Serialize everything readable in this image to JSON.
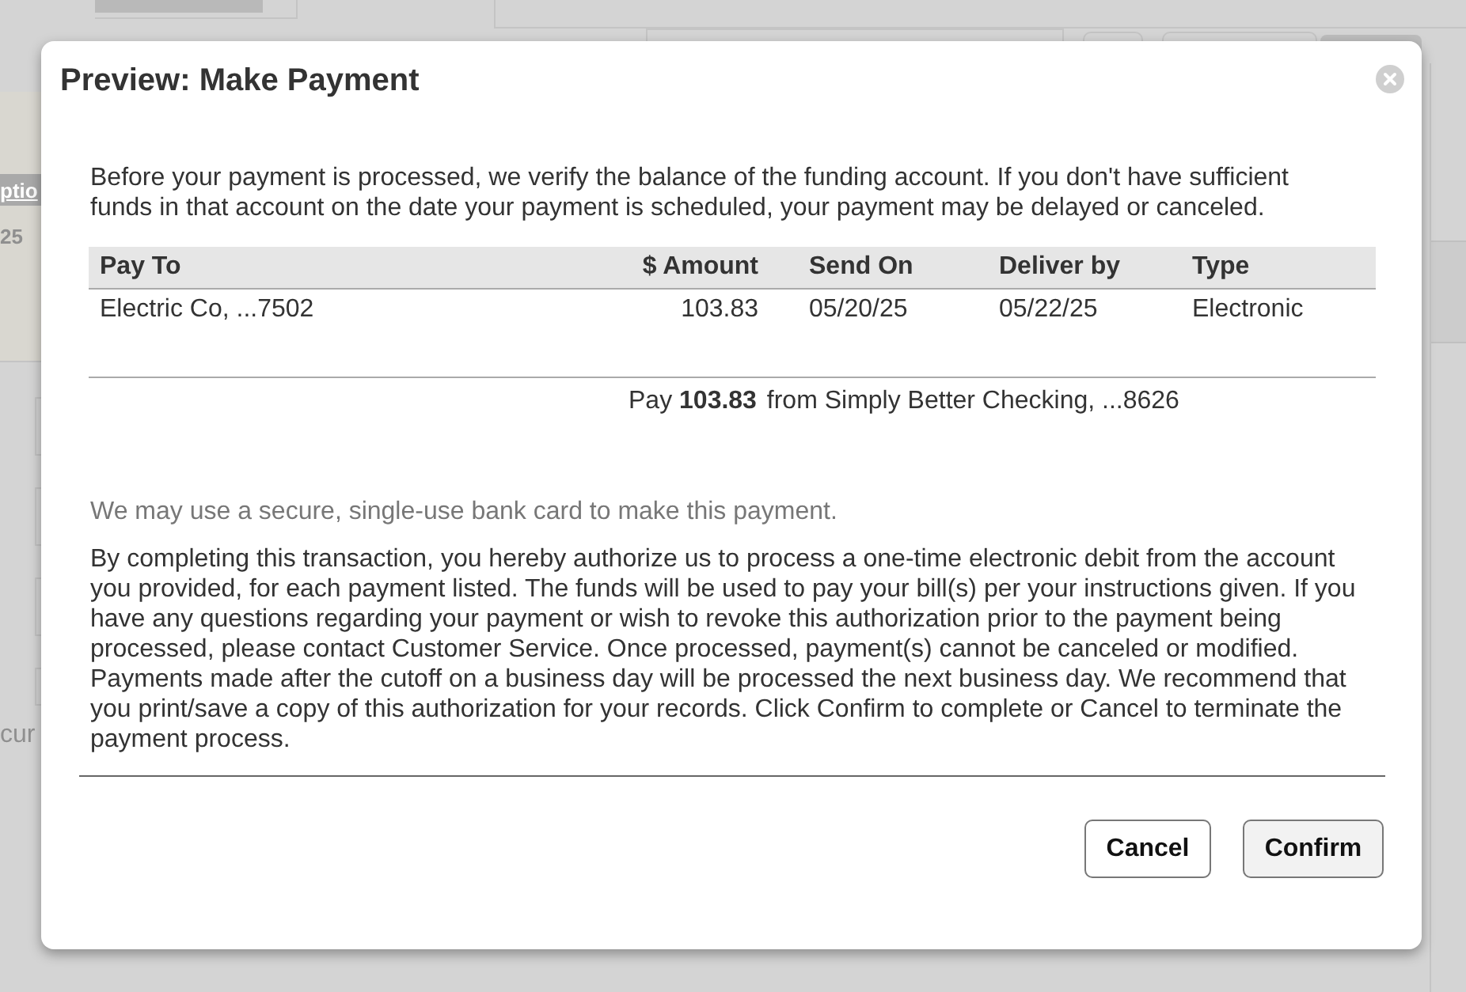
{
  "background_page": {
    "panel_label": "ptio",
    "panel_value": "25",
    "fragment": "cur"
  },
  "dialog": {
    "title": "Preview: Make Payment",
    "intro": "Before your payment is processed, we verify the balance of the funding account. If you don't have sufficient funds in that account on the date your payment is scheduled, your payment may be delayed or canceled.",
    "table": {
      "columns": [
        "Pay To",
        "$ Amount",
        "Send On",
        "Deliver by",
        "Type"
      ],
      "rows": [
        [
          "Electric Co, ...7502",
          "103.83",
          "05/20/25",
          "05/22/25",
          "Electronic"
        ]
      ]
    },
    "summary": "Pay **103.83** from Simply Better Checking, ...8626",
    "note": "We may use a secure, single-use bank card to make this payment.",
    "authorization": "By completing this transaction, you hereby authorize us to process a one-time electronic debit from the account you provided, for each payment listed. The funds will be used to pay your bill(s) per your instructions given. If you have any questions regarding your payment or wish to revoke this authorization prior to the payment being processed, please contact Customer Service. Once processed, payment(s) cannot be canceled or modified. Payments made after the cutoff on a business day will be processed the next business day. We recommend that you print/save a copy of this authorization for your records. Click Confirm to complete or Cancel to terminate the payment process.",
    "buttons": [
      {
        "label": "Cancel",
        "kind": "secondary"
      },
      {
        "label": "Confirm",
        "kind": "primary"
      }
    ]
  }
}
